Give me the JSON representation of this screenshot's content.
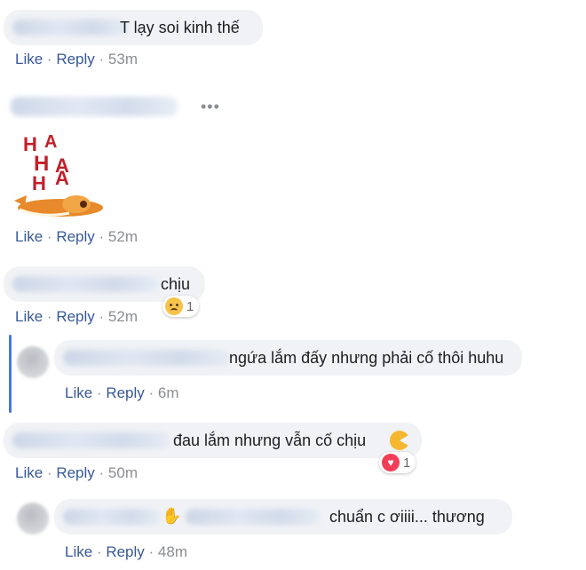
{
  "comments": [
    {
      "text": "T lạy soi kinh thế",
      "like": "Like",
      "reply": "Reply",
      "time": "53m"
    },
    {
      "sticker_letters": "HAHAHA",
      "like": "Like",
      "reply": "Reply",
      "time": "52m"
    },
    {
      "text": "chịu",
      "like": "Like",
      "reply": "Reply",
      "time": "52m",
      "reaction_count": "1",
      "reaction": "sad-face"
    },
    {
      "text": "ngứa lắm đấy nhưng phải cố thôi huhu",
      "like": "Like",
      "reply": "Reply",
      "time": "6m"
    },
    {
      "text": "đau lắm nhưng vẫn cố chịu",
      "like": "Like",
      "reply": "Reply",
      "time": "50m",
      "reaction_count": "1",
      "reaction": "heart"
    },
    {
      "text": "chuẩn c ơiiii... thương",
      "like": "Like",
      "reply": "Reply",
      "time": "48m"
    }
  ],
  "separator": "·",
  "colors": {
    "link": "#385898",
    "bubble": "#f0f2f5",
    "thread": "#4a78d6"
  }
}
